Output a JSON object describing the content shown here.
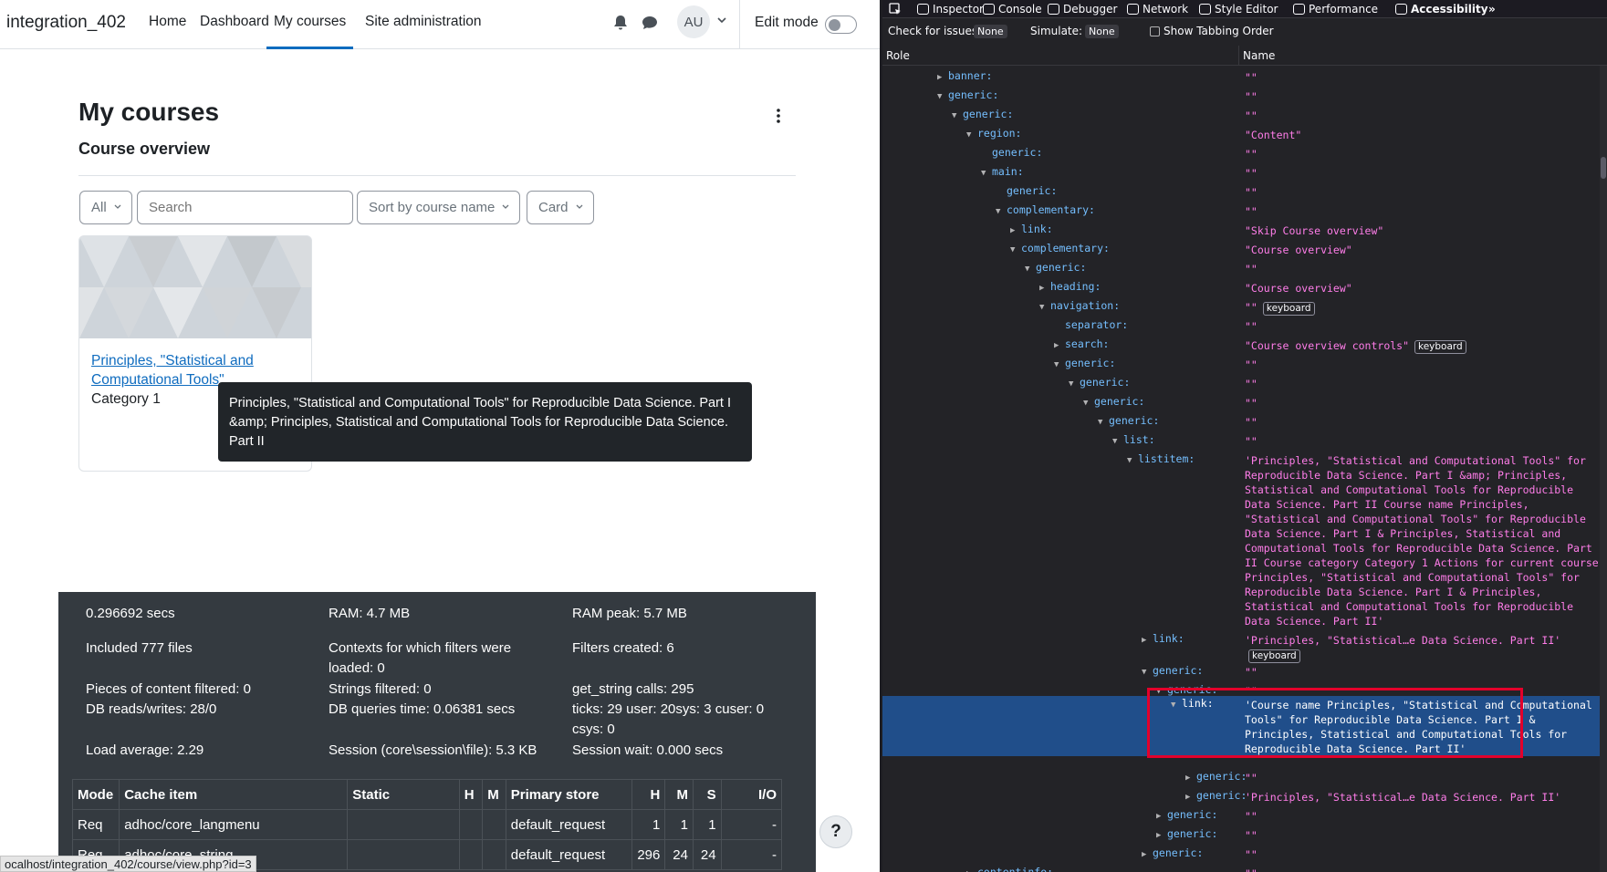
{
  "site": {
    "brand": "integration_402"
  },
  "nav": {
    "home": "Home",
    "dashboard": "Dashboard",
    "my_courses": "My courses",
    "site_admin": "Site administration"
  },
  "user": {
    "initials": "AU"
  },
  "edit_mode": {
    "label": "Edit mode",
    "state": "off"
  },
  "page": {
    "title": "My courses",
    "section": "Course overview"
  },
  "controls": {
    "filter": "All",
    "search_placeholder": "Search",
    "sort": "Sort by course name",
    "view": "Card"
  },
  "course_card": {
    "name": "Principles, \"Statistical and Computational Tools\"...",
    "category": "Category 1"
  },
  "tooltip": {
    "text": "Principles, \"Statistical and Computational Tools\" for Reproducible Data Science. Part I &amp; Principles, Statistical and Computational Tools for Reproducible Data Science. Part II"
  },
  "perf": {
    "items": [
      "0.296692 secs",
      "RAM: 4.7 MB",
      "RAM peak: 5.7 MB",
      "Included 777 files",
      "Contexts for which filters were loaded: 0",
      "Filters created: 6",
      "Pieces of content filtered: 0",
      "Strings filtered: 0",
      "get_string calls: 295",
      "DB reads/writes: 28/0",
      "DB queries time: 0.06381 secs",
      "ticks: 29 user: 20sys: 3 cuser: 0 csys: 0",
      "Load average: 2.29",
      "Session (core\\session\\file): 5.3 KB",
      "Session wait: 0.000 secs"
    ],
    "table_headers": [
      "Mode",
      "Cache item",
      "Static",
      "H",
      "M",
      "Primary store",
      "H",
      "M",
      "S",
      "I/O"
    ],
    "rows": [
      [
        "Req",
        "adhoc/core_langmenu",
        "",
        "",
        "",
        "default_request",
        "1",
        "1",
        "1",
        "-"
      ],
      [
        "Req",
        "adhoc/core_string",
        "",
        "",
        "",
        "default_request",
        "296",
        "24",
        "24",
        "-"
      ]
    ]
  },
  "help": {
    "label": "?"
  },
  "status_url": "ocalhost/integration_402/course/view.php?id=3",
  "devtools": {
    "tabs": [
      "Inspector",
      "Console",
      "Debugger",
      "Network",
      "Style Editor",
      "Performance",
      "Accessibility"
    ],
    "check_issues_label": "Check for issues:",
    "check_issues_value": "None",
    "simulate_label": "Simulate:",
    "simulate_value": "None",
    "tabbing_label": "Show Tabbing Order",
    "col_role": "Role",
    "col_name": "Name",
    "keyboard_badge": "keyboard",
    "tree": [
      {
        "d": 0,
        "t": "c",
        "role": "banner:",
        "name": "\"\""
      },
      {
        "d": 0,
        "t": "e",
        "role": "generic:",
        "name": "\"\""
      },
      {
        "d": 1,
        "t": "e",
        "role": "generic:",
        "name": "\"\""
      },
      {
        "d": 2,
        "t": "e",
        "role": "region:",
        "name": "\"Content\""
      },
      {
        "d": 3,
        "t": "",
        "role": "generic:",
        "name": "\"\""
      },
      {
        "d": 3,
        "t": "e",
        "role": "main:",
        "name": "\"\""
      },
      {
        "d": 4,
        "t": "",
        "role": "generic:",
        "name": "\"\""
      },
      {
        "d": 4,
        "t": "e",
        "role": "complementary:",
        "name": "\"\""
      },
      {
        "d": 5,
        "t": "c",
        "role": "link:",
        "name": "\"Skip Course overview\""
      },
      {
        "d": 5,
        "t": "e",
        "role": "complementary:",
        "name": "\"Course overview\""
      },
      {
        "d": 6,
        "t": "e",
        "role": "generic:",
        "name": "\"\""
      },
      {
        "d": 7,
        "t": "c",
        "role": "heading:",
        "name": "\"Course overview\""
      },
      {
        "d": 7,
        "t": "e",
        "role": "navigation:",
        "name": "\"\"",
        "kbd": true
      },
      {
        "d": 8,
        "t": "",
        "role": "separator:",
        "name": "\"\""
      },
      {
        "d": 8,
        "t": "c",
        "role": "search:",
        "name": "\"Course overview controls\"",
        "kbd": true
      },
      {
        "d": 8,
        "t": "e",
        "role": "generic:",
        "name": "\"\""
      },
      {
        "d": 9,
        "t": "e",
        "role": "generic:",
        "name": "\"\""
      },
      {
        "d": 10,
        "t": "e",
        "role": "generic:",
        "name": "\"\""
      },
      {
        "d": 11,
        "t": "e",
        "role": "generic:",
        "name": "\"\""
      },
      {
        "d": 12,
        "t": "e",
        "role": "list:",
        "name": "\"\""
      },
      {
        "d": 13,
        "t": "e",
        "role": "listitem:",
        "name": "'Principles, \"Statistical and Computational Tools\" for Reproducible Data Science. Part I &amp; Principles, Statistical and Computational Tools for Reproducible Data Science. Part II Course name Principles, \"Statistical and Computational Tools\" for Reproducible Data Science. Part I & Principles, Statistical and Computational Tools for Reproducible Data Science. Part II Course category Category 1 Actions for current course Principles, \"Statistical and Computational Tools\" for Reproducible Data Science. Part I & Principles, Statistical and Computational Tools for Reproducible Data Science. Part II'"
      },
      {
        "d": 14,
        "t": "c",
        "role": "link:",
        "name": "'Principles, \"Statistical…e Data Science. Part II'",
        "kbd": true
      },
      {
        "d": 14,
        "t": "e",
        "role": "generic:",
        "name": "\"\""
      },
      {
        "d": 15,
        "t": "e",
        "role": "generic:",
        "name": "\"\""
      },
      {
        "d": 16,
        "t": "e",
        "role": "link:",
        "name": "'Course name Principles, \"Statistical and Computational Tools\" for Reproducible Data Science. Part I & Principles, Statistical and Computational Tools for Reproducible Data Science. Part II'",
        "sel": true
      },
      {
        "d": 17,
        "t": "c",
        "role": "generic:",
        "name": "\"\""
      },
      {
        "d": 17,
        "t": "c",
        "role": "generic:",
        "name": "'Principles, \"Statistical…e Data Science. Part II'"
      },
      {
        "d": 15,
        "t": "c",
        "role": "generic:",
        "name": "\"\""
      },
      {
        "d": 15,
        "t": "c",
        "role": "generic:",
        "name": "\"\""
      },
      {
        "d": 14,
        "t": "c",
        "role": "generic:",
        "name": "\"\""
      },
      {
        "d": 2,
        "t": "c",
        "role": "contentinfo:",
        "name": "\"\""
      }
    ]
  }
}
